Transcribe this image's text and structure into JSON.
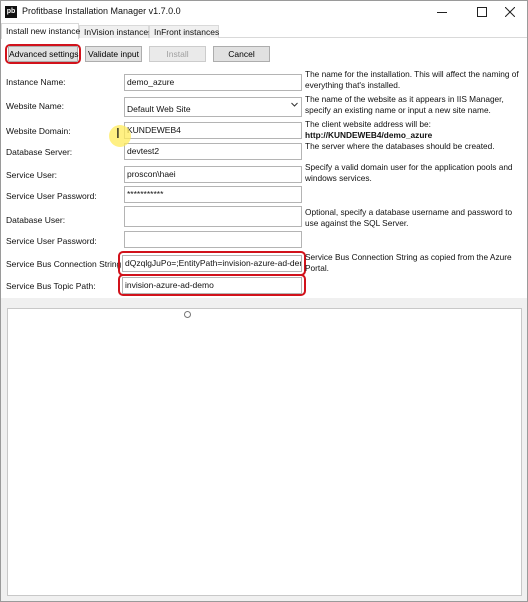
{
  "window": {
    "title": "Profitbase Installation Manager v1.7.0.0",
    "icon_text": "pb"
  },
  "tabs": [
    {
      "label": "Install new instance"
    },
    {
      "label": "InVision instances"
    },
    {
      "label": "InFront instances"
    }
  ],
  "toolbar": {
    "advanced_label": "Advanced settings",
    "validate_label": "Validate input",
    "install_label": "Install",
    "cancel_label": "Cancel"
  },
  "form": {
    "instance_name": {
      "label": "Instance Name:",
      "value": "demo_azure",
      "desc": "The name for the installation. This will affect the naming of everything that's installed."
    },
    "website_name": {
      "label": "Website Name:",
      "value": "Default Web Site",
      "desc": "The name of the website as it appears in IIS Manager, specify an existing name or input a new site name."
    },
    "website_domain": {
      "label": "Website Domain:",
      "value": "KUNDEWEB4",
      "desc": "The client website address will be:",
      "desc_bold": "http://KUNDEWEB4/demo_azure"
    },
    "database_server": {
      "label": "Database Server:",
      "value": "devtest2",
      "desc": "The server where the databases should be created."
    },
    "service_user": {
      "label": "Service User:",
      "value": "proscon\\haei",
      "desc": "Specify a valid domain user for the application pools and windows services."
    },
    "service_user_password": {
      "label": "Service User Password:",
      "value": "***********"
    },
    "database_user": {
      "label": "Database User:",
      "value": "",
      "desc": "Optional, specify a database username and password to use against the SQL Server."
    },
    "database_user_password": {
      "label": "Service User Password:",
      "value": ""
    },
    "service_bus_conn": {
      "label": "Service Bus Connection String:",
      "value": "dQzqlgJuPo=;EntityPath=invision-azure-ad-demo",
      "desc": "Service Bus Connection String as copied from the Azure Portal."
    },
    "service_bus_topic": {
      "label": "Service Bus Topic Path:",
      "value": "invision-azure-ad-demo"
    }
  },
  "icons": {
    "minimize": "minimize-icon",
    "maximize": "maximize-icon",
    "close": "close-icon",
    "dropdown": "chevron-down-icon",
    "text_cursor": "text-cursor-icon"
  },
  "colors": {
    "highlight_ring": "#d1121b",
    "cursor_halo": "#ffeb5a"
  }
}
